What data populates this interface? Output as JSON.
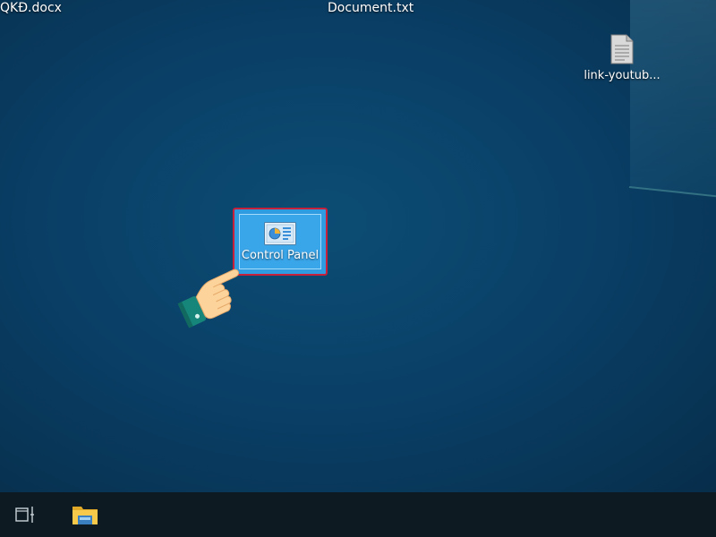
{
  "desktop": {
    "top_files": [
      {
        "label": "QKĐ.docx"
      },
      {
        "label": "Document.txt"
      }
    ],
    "right_icon": {
      "label": "link-youtub...",
      "icon": "text-file-icon"
    },
    "selected_icon": {
      "label": "Control Panel",
      "icon": "control-panel-icon"
    }
  },
  "taskbar": {
    "items": [
      {
        "icon": "task-view-icon"
      },
      {
        "icon": "file-explorer-icon"
      }
    ]
  },
  "colors": {
    "selection_border": "#c7203a",
    "selection_fill": "#3aa6ea",
    "taskbar": "#0e1a22"
  }
}
